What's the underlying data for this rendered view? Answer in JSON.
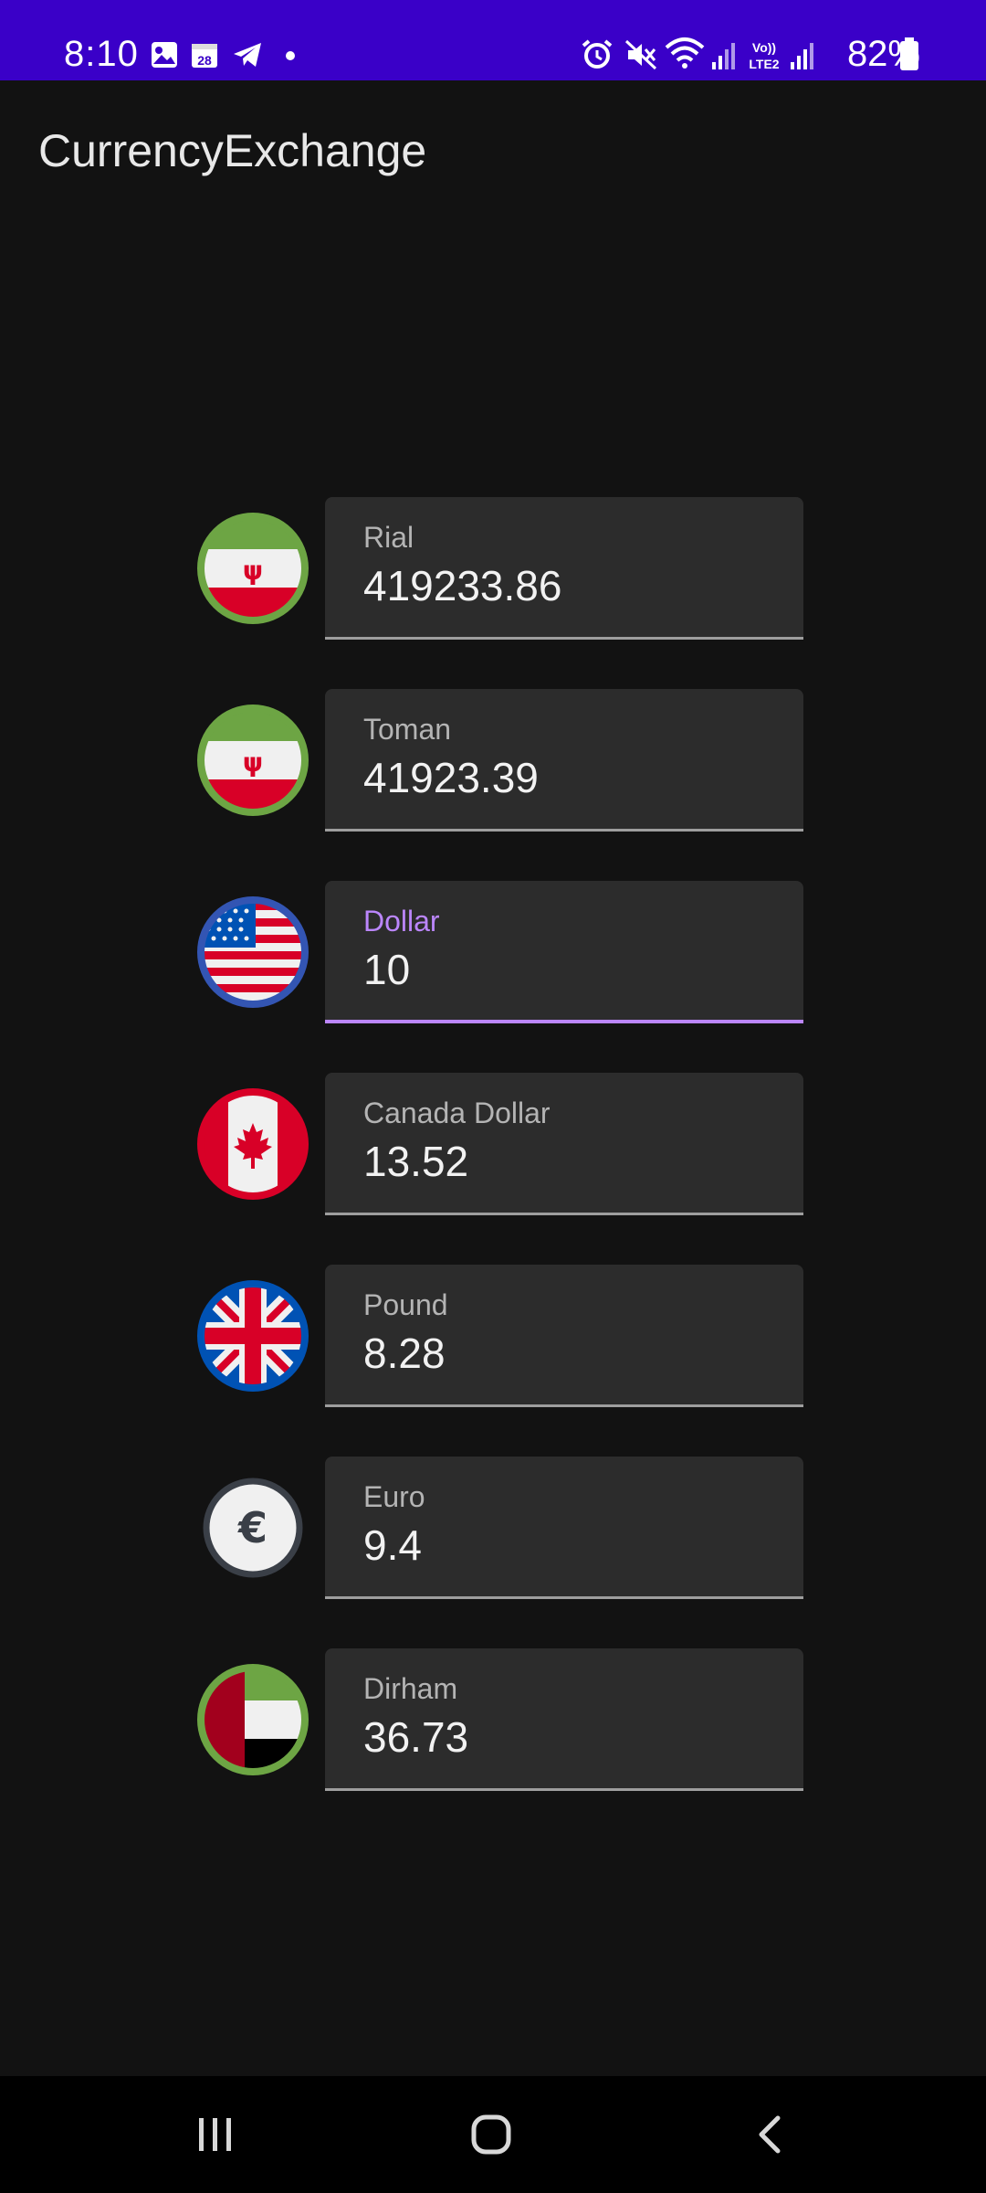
{
  "status_bar": {
    "time": "8:10",
    "battery_percent": "82%",
    "calendar_day": "28",
    "network_label": "VoLTE2",
    "background_color": "#3a00c8"
  },
  "app_bar": {
    "title": "CurrencyExchange"
  },
  "currencies": [
    {
      "label": "Rial",
      "value": "419233.86",
      "flag_icon": "iran-flag-icon",
      "focused": false
    },
    {
      "label": "Toman",
      "value": "41923.39",
      "flag_icon": "iran-flag-icon",
      "focused": false
    },
    {
      "label": "Dollar",
      "value": "10",
      "flag_icon": "usa-flag-icon",
      "focused": true
    },
    {
      "label": "Canada Dollar",
      "value": "13.52",
      "flag_icon": "canada-flag-icon",
      "focused": false
    },
    {
      "label": "Pound",
      "value": "8.28",
      "flag_icon": "uk-flag-icon",
      "focused": false
    },
    {
      "label": "Euro",
      "value": "9.4",
      "flag_icon": "euro-icon",
      "focused": false
    },
    {
      "label": "Dirham",
      "value": "36.73",
      "flag_icon": "uae-flag-icon",
      "focused": false
    }
  ],
  "euro_symbol": "€",
  "colors": {
    "accent": "#bb86fc",
    "field_background": "#2c2c2c",
    "screen_background": "#121212"
  },
  "nav_bar": {
    "buttons": [
      "recent-apps",
      "home",
      "back"
    ]
  }
}
